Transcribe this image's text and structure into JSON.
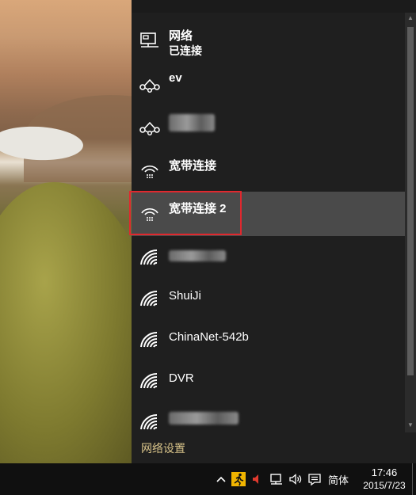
{
  "networks": [
    {
      "name": "网络",
      "status": "已连接",
      "icon": "ethernet-icon"
    },
    {
      "name": "ev",
      "icon": "dialup-icon"
    },
    {
      "name": "",
      "icon": "dialup-icon"
    },
    {
      "name": "宽带连接",
      "icon": "broadband-icon"
    },
    {
      "name": "宽带连接 2",
      "icon": "broadband-icon"
    },
    {
      "name": "",
      "icon": "wifi-icon"
    },
    {
      "name": "ShuiJi",
      "icon": "wifi-icon"
    },
    {
      "name": "ChinaNet-542b",
      "icon": "wifi-icon"
    },
    {
      "name": "DVR",
      "icon": "wifi-icon"
    },
    {
      "name": "",
      "icon": "wifi-icon"
    }
  ],
  "settings_link": "网络设置",
  "taskbar": {
    "ime": "简体",
    "time": "17:46",
    "date": "2015/7/23"
  },
  "colors": {
    "flyout_bg": "#1f1f1f",
    "selected_bg": "#4a4a4a",
    "highlight_border": "#e0282e",
    "settings_link": "#d9c48a"
  }
}
